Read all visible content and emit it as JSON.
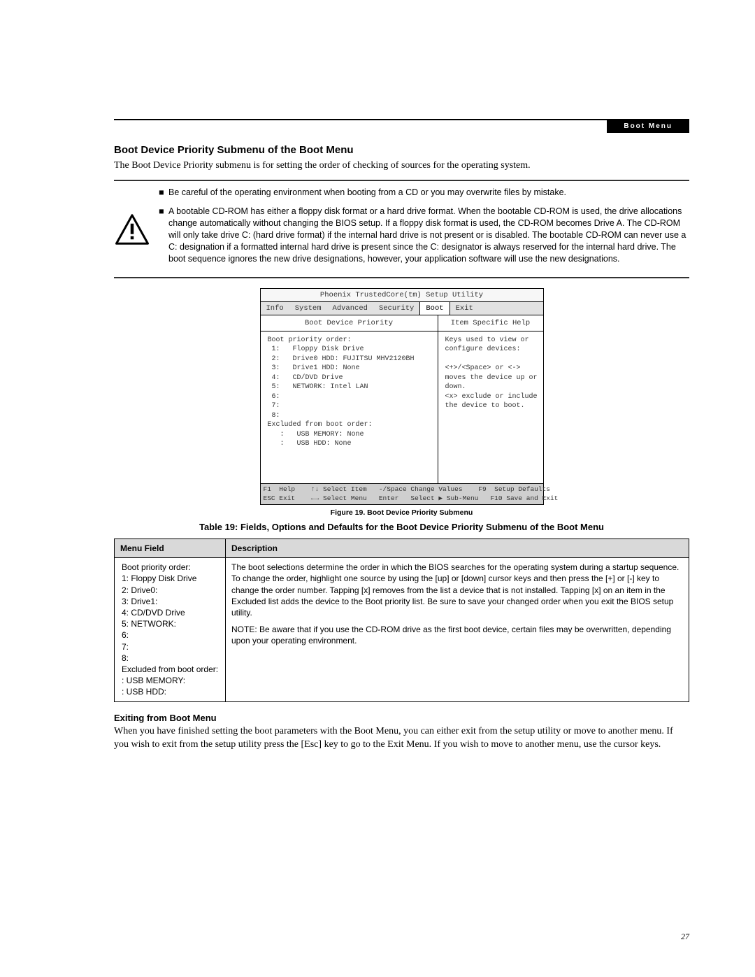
{
  "chapter_label": "Boot Menu",
  "section_heading": "Boot Device Priority Submenu of the Boot Menu",
  "intro_paragraph": "The Boot Device Priority submenu is for setting the order of checking of sources for the operating system.",
  "warning": {
    "bullets": [
      "Be careful of the operating environment when booting from a CD or you may overwrite files by mistake.",
      "A bootable CD-ROM has either a floppy disk format or a hard drive format. When the bootable CD-ROM is used, the drive allocations change automatically without changing the BIOS setup. If a floppy disk format is used, the CD-ROM becomes Drive A. The CD-ROM will only take drive C: (hard drive format) if the internal hard drive is not present or is disabled. The bootable CD-ROM can never use a C: designation if a formatted internal hard drive is present since the C: designator is always reserved for the internal hard drive. The boot sequence ignores the new drive designations, however, your application software will use the new designations."
    ]
  },
  "bios": {
    "utility_title": "Phoenix TrustedCore(tm) Setup Utility",
    "tabs": [
      "Info",
      "System",
      "Advanced",
      "Security",
      "Boot",
      "Exit"
    ],
    "active_tab_index": 4,
    "left_header": "Boot Device Priority",
    "right_header": "Item Specific Help",
    "priority_header": "Boot priority order:",
    "priority_items": [
      "1:   Floppy Disk Drive",
      "2:   Drive0 HDD: FUJITSU MHV2120BH",
      "3:   Drive1 HDD: None",
      "4:   CD/DVD Drive",
      "5:   NETWORK: Intel LAN",
      "6:",
      "7:",
      "8:"
    ],
    "excluded_header": "Excluded from boot order:",
    "excluded_items": [
      ":   USB MEMORY: None",
      ":   USB HDD: None"
    ],
    "help_lines": [
      "Keys used to view or",
      "configure devices:",
      "",
      "<+>/<Space> or <->",
      "moves the device up or",
      "down.",
      "<x> exclude or include",
      "the device to boot."
    ],
    "footer1_keys": "F1  Help    ↑↓ Select Item   -/Space Change Values    F9  Setup Defaults",
    "footer2_keys": "ESC Exit    ←→ Select Menu   Enter   Select ▶ Sub-Menu   F10 Save and Exit"
  },
  "figure_caption": "Figure 19.  Boot Device Priority Submenu",
  "table_title": "Table 19: Fields, Options and Defaults for the Boot Device Priority Submenu of the Boot Menu",
  "table": {
    "col_menu": "Menu Field",
    "col_desc": "Description",
    "menu_field_text": "Boot priority order:\n  1:  Floppy Disk Drive\n  2:  Drive0:\n  3:  Drive1:\n  4:  CD/DVD Drive\n  5:  NETWORK:\n  6:\n  7:\n  8:\nExcluded from boot order:\n   :  USB MEMORY:\n   :  USB HDD:",
    "description_para1": "The boot selections determine the order in which the BIOS searches for the operating system during a startup sequence. To change the order, highlight one source by using the [up] or [down] cursor keys and then press the [+] or [-] key to change the order number. Tapping [x] removes from the list a device that is not installed. Tapping [x] on an item in the Excluded list adds the device to the Boot priority list. Be sure to save your changed order when you exit the BIOS setup utility.",
    "description_para2": "NOTE: Be aware that if you use the CD-ROM drive as the first boot device, certain files may be overwritten, depending upon your operating environment."
  },
  "exiting": {
    "heading": "Exiting from Boot Menu",
    "body": "When you have finished setting the boot parameters with the Boot Menu, you can either exit from the setup utility or move to another menu. If you wish to exit from the setup utility press the [Esc] key to go to the Exit Menu. If you wish to move to another menu, use the cursor keys."
  },
  "page_number": "27"
}
